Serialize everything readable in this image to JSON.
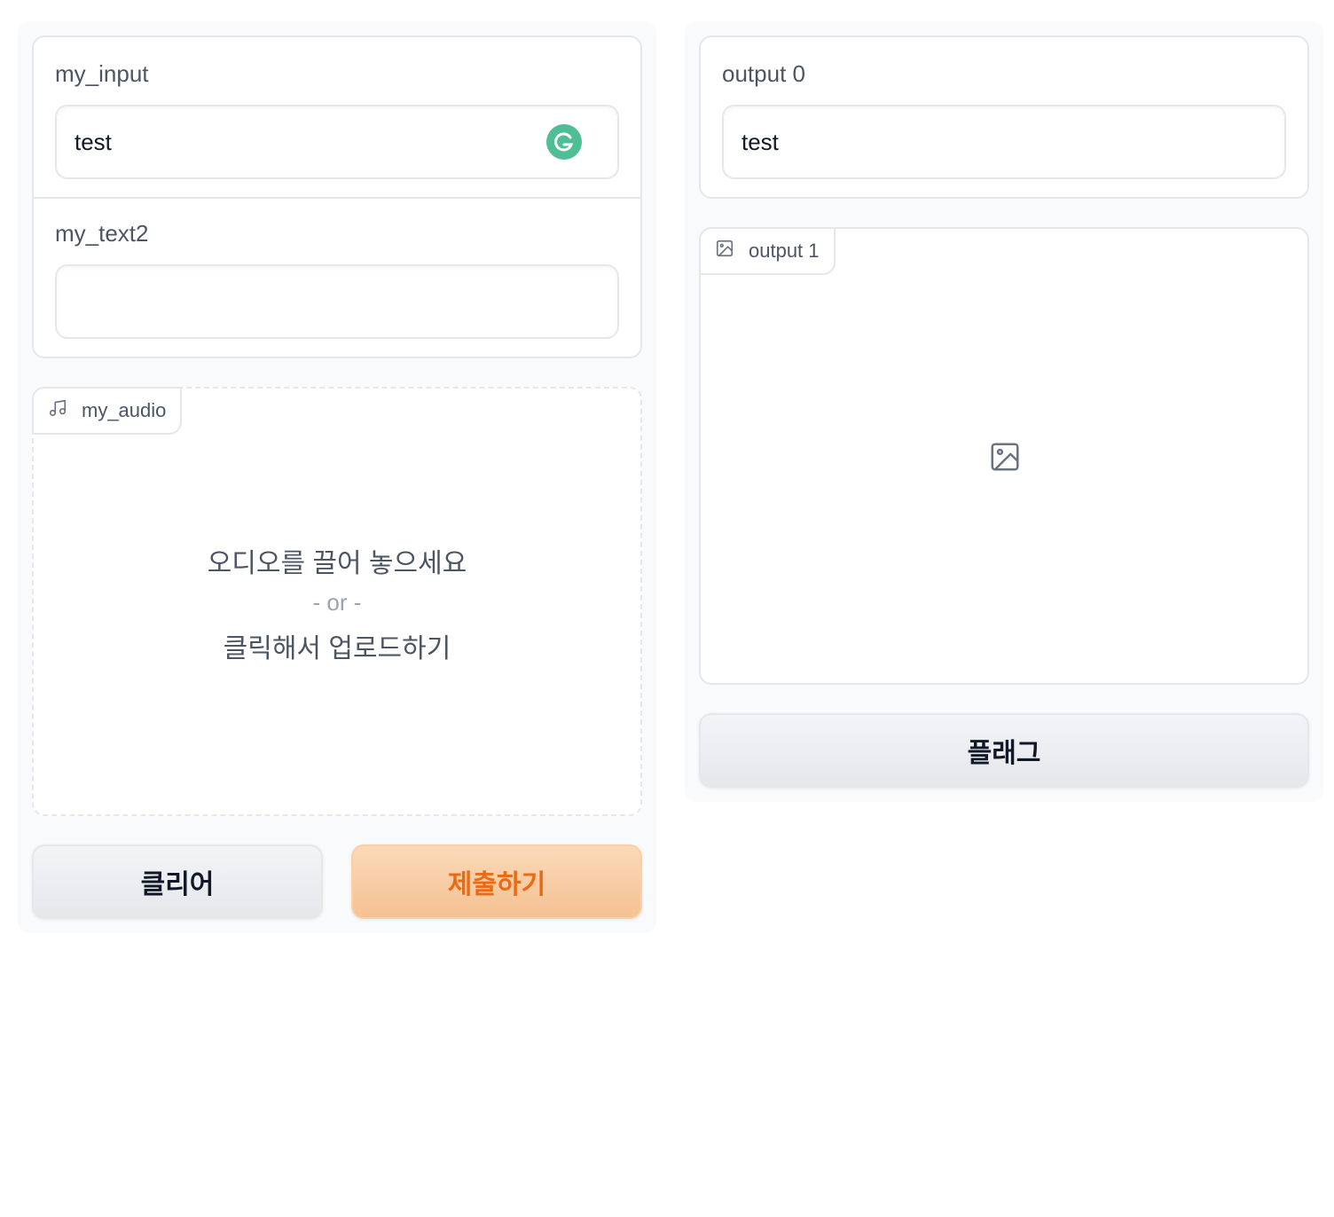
{
  "left": {
    "my_input": {
      "label": "my_input",
      "value": "test"
    },
    "my_text2": {
      "label": "my_text2",
      "value": ""
    },
    "audio": {
      "label": "my_audio",
      "drop_text": "오디오를 끌어 놓으세요",
      "or_text": "- or -",
      "click_text": "클릭해서 업로드하기"
    },
    "buttons": {
      "clear": "클리어",
      "submit": "제출하기"
    }
  },
  "right": {
    "output0": {
      "label": "output 0",
      "value": "test"
    },
    "output1": {
      "label": "output 1"
    },
    "flag_button": "플래그"
  },
  "colors": {
    "accent": "#ea6b14",
    "grammarly": "#4fbe94"
  },
  "icons": [
    "grammarly-icon",
    "music-note-icon",
    "image-icon"
  ]
}
